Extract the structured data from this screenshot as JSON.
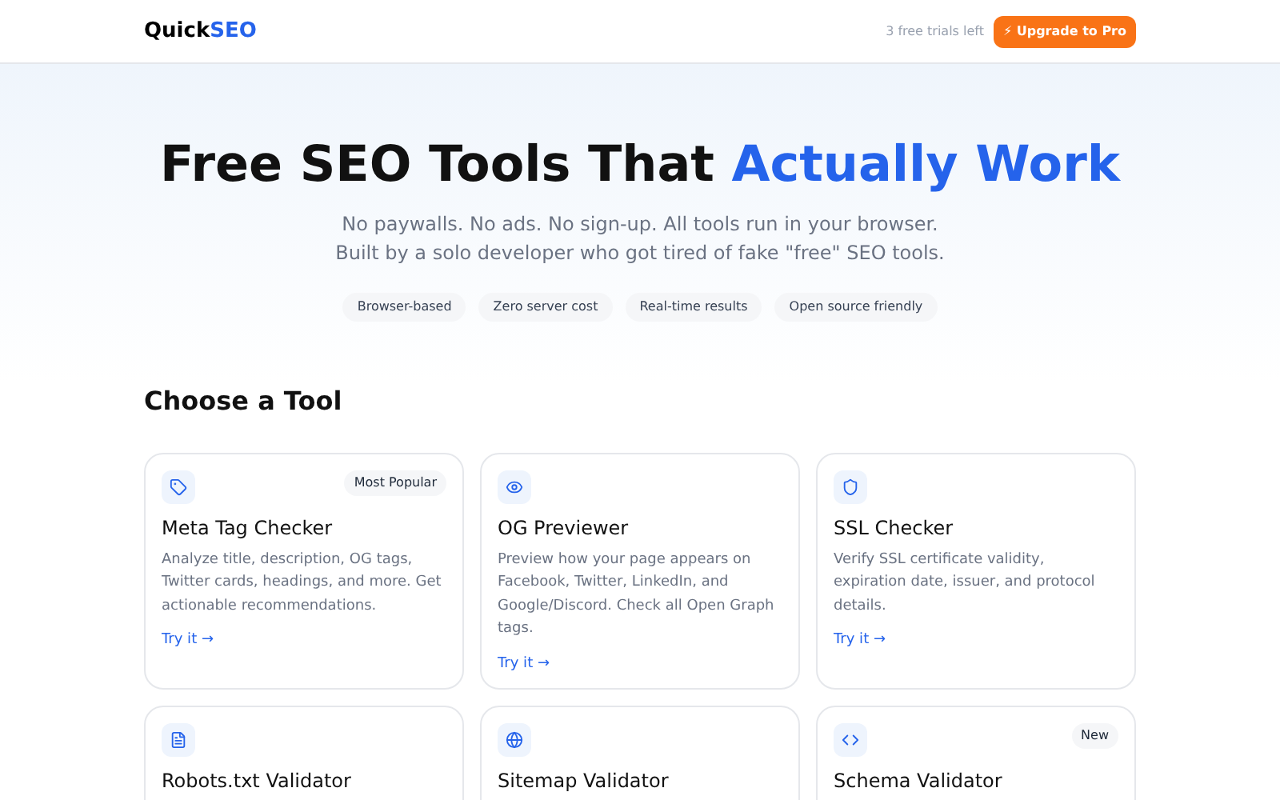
{
  "header": {
    "logo_start": "Quick",
    "logo_accent": "SEO",
    "trials": "3 free trials left",
    "upgrade_button": "⚡ Upgrade to Pro"
  },
  "hero": {
    "title_start": "Free SEO Tools That ",
    "title_accent": "Actually Work",
    "subtitle_lines": [
      "No paywalls. No ads. No sign-up. All tools run in your browser.",
      "Built by a solo developer who got tired of fake \"free\" SEO tools."
    ],
    "features": [
      "Browser-based",
      "Zero server cost",
      "Real-time results",
      "Open source friendly"
    ]
  },
  "section_title": "Choose a Tool",
  "tools": [
    {
      "title": "Meta Tag Checker",
      "badge": "Most Popular",
      "description": "Analyze title, description, OG tags, Twitter cards, headings, and more. Get actionable recommendations.",
      "link": "Try it →"
    },
    {
      "title": "OG Previewer",
      "description": "Preview how your page appears on Facebook, Twitter, LinkedIn, and Google/Discord. Check all Open Graph tags.",
      "link": "Try it →"
    },
    {
      "title": "SSL Checker",
      "description": "Verify SSL certificate validity, expiration date, issuer, and protocol details.",
      "link": "Try it →"
    },
    {
      "title": "Robots.txt Validator"
    },
    {
      "title": "Sitemap Validator"
    },
    {
      "title": "Schema Validator",
      "badge": "New"
    }
  ]
}
